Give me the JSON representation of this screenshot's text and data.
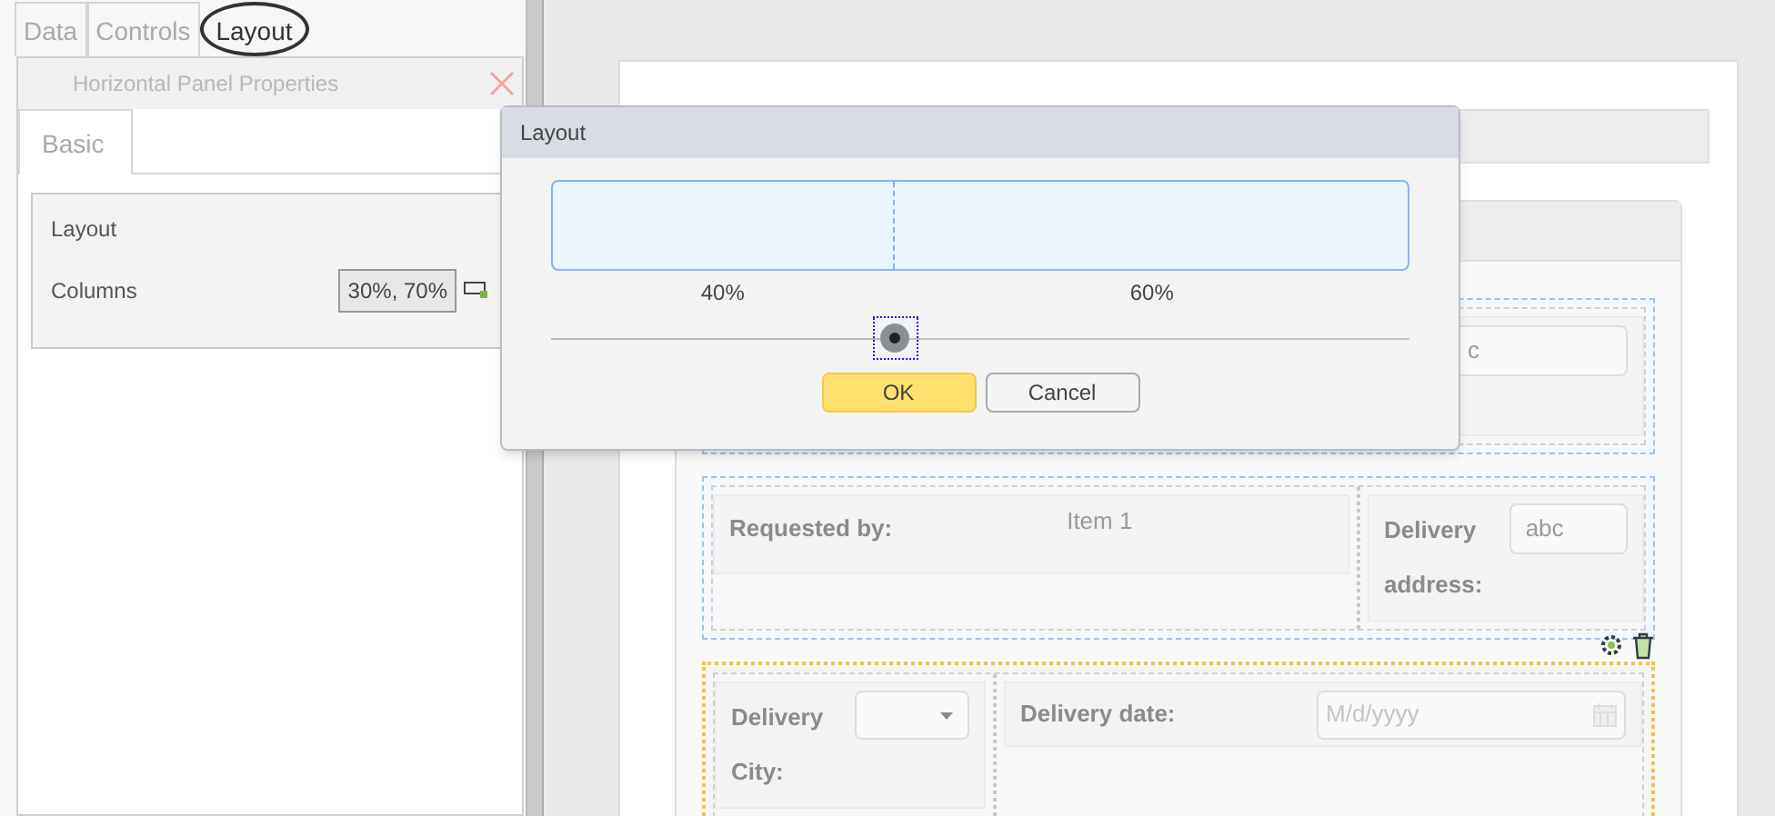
{
  "left_tabs": [
    {
      "label": "Data",
      "selected": false
    },
    {
      "label": "Controls",
      "selected": false
    },
    {
      "label": "Layout",
      "selected": true
    }
  ],
  "properties": {
    "title": "Horizontal Panel Properties",
    "tabs": [
      {
        "label": "Basic",
        "selected": true
      }
    ],
    "group": "Layout",
    "fields": [
      {
        "label": "Columns",
        "value": "30%, 70%"
      }
    ]
  },
  "form": {
    "rows": [
      {
        "selected": false,
        "cells": [
          {
            "kind": "textbox",
            "value": "c"
          }
        ]
      },
      {
        "selected": false,
        "cells": [
          {
            "kind": "text",
            "label": "Requested by:",
            "value": "Item 1"
          },
          {
            "kind": "textbox",
            "label": "Delivery address:",
            "value": "abc"
          }
        ]
      },
      {
        "selected": true,
        "cells": [
          {
            "kind": "dropdown",
            "label": "Delivery City:"
          },
          {
            "kind": "date",
            "label": "Delivery date:",
            "placeholder": "M/d/yyyy"
          }
        ]
      }
    ]
  },
  "dialog": {
    "title": "Layout",
    "columns": [
      "40%",
      "60%"
    ],
    "slider": {
      "level": 0.4
    },
    "buttons": [
      {
        "label": "OK",
        "kind": "primary"
      },
      {
        "label": "Cancel",
        "kind": "secondary"
      }
    ]
  }
}
